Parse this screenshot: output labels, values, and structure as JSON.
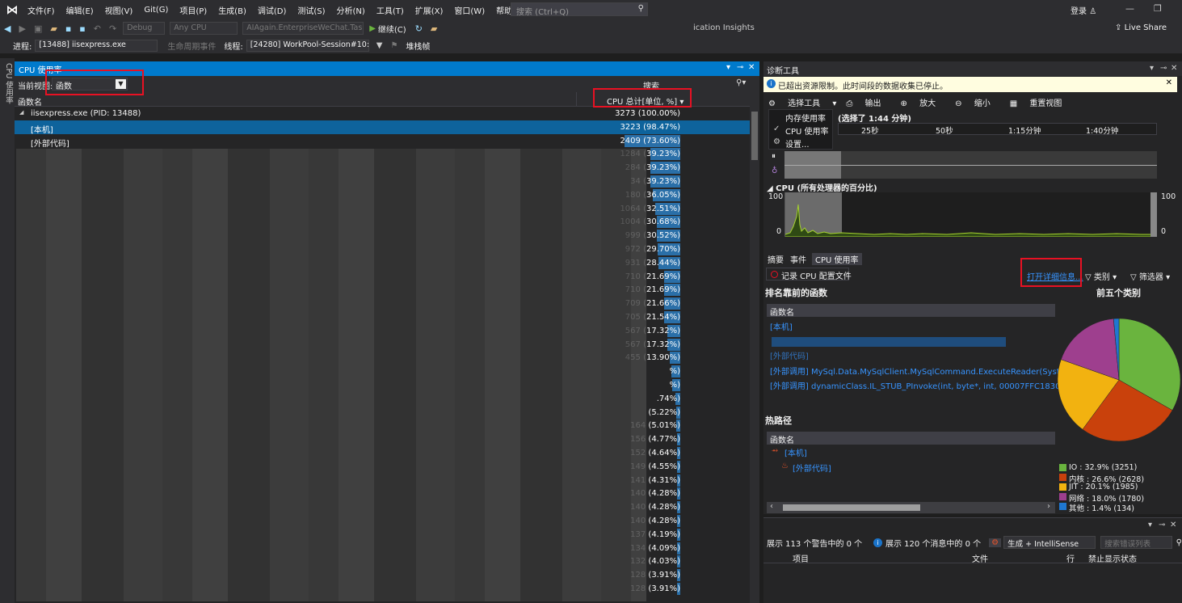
{
  "menubar": {
    "items": [
      "文件(F)",
      "编辑(E)",
      "视图(V)",
      "Git(G)",
      "项目(P)",
      "生成(B)",
      "调试(D)",
      "测试(S)",
      "分析(N)",
      "工具(T)",
      "扩展(X)",
      "窗口(W)",
      "帮助(H)"
    ],
    "search_placeholder": "搜索 (Ctrl+Q)",
    "login": "登录"
  },
  "toolbar": {
    "config": "Debug",
    "platform": "Any CPU",
    "project": "AIAgain.EnterpriseWeChat.Task",
    "continue": "继续(C)",
    "insights": "ication Insights",
    "live_share": "Live Share"
  },
  "procbar": {
    "process_label": "进程:",
    "process_value": "[13488] iisexpress.exe",
    "lifecycle_label": "生命周期事件",
    "thread_label": "线程:",
    "thread_value": "[24280] WorkPool-Session#10:",
    "stack_label": "堆栈帧"
  },
  "sidetab": {
    "label": "CPU 使用率"
  },
  "cpu_panel": {
    "title": "CPU 使用率",
    "current_view_label": "当前视图:",
    "current_view_value": "函数",
    "search_label": "搜索",
    "col_name": "函数名",
    "col_cpu": "CPU 总计[单位, %]",
    "rows": [
      {
        "name": "iisexpress.exe (PID: 13488)",
        "value": "3273 (100.00%)",
        "pct": 100.0
      },
      {
        "name": "[本机]",
        "value": "3223 (98.47%)",
        "pct": 98.47
      },
      {
        "name": "[外部代码]",
        "value": "2409 (73.60%)",
        "pct": 73.6
      },
      {
        "name": "",
        "value": "1284 (39.23%)",
        "pct": 39.23
      },
      {
        "name": "",
        "value": "284 (39.23%)",
        "pct": 39.23
      },
      {
        "name": "",
        "value": "34 (39.23%)",
        "pct": 39.23
      },
      {
        "name": "",
        "value": "180 (36.05%)",
        "pct": 36.05
      },
      {
        "name": "",
        "value": "1064 (32.51%)",
        "pct": 32.51
      },
      {
        "name": "",
        "value": "1004 (30.68%)",
        "pct": 30.68
      },
      {
        "name": "",
        "value": "999 (30.52%)",
        "pct": 30.52
      },
      {
        "name": "",
        "value": "972 (29.70%)",
        "pct": 29.7
      },
      {
        "name": "",
        "value": "931 (28.44%)",
        "pct": 28.44
      },
      {
        "name": "",
        "value": "710 (21.69%)",
        "pct": 21.69
      },
      {
        "name": "",
        "value": "710 (21.69%)",
        "pct": 21.69
      },
      {
        "name": "",
        "value": "709 (21.66%)",
        "pct": 21.66
      },
      {
        "name": "",
        "value": "705 (21.54%)",
        "pct": 21.54
      },
      {
        "name": "",
        "value": "567 (17.32%)",
        "pct": 17.32
      },
      {
        "name": "",
        "value": "567 (17.32%)",
        "pct": 17.32
      },
      {
        "name": "",
        "value": "455 (13.90%)",
        "pct": 13.9
      },
      {
        "name": "",
        "value": "%)",
        "pct": 12.0
      },
      {
        "name": "",
        "value": "%)",
        "pct": 11.0
      },
      {
        "name": "",
        "value": ".74%)",
        "pct": 6.74
      },
      {
        "name": "",
        "value": "(5.22%)",
        "pct": 5.22
      },
      {
        "name": "",
        "value": "164 (5.01%)",
        "pct": 5.01
      },
      {
        "name": "",
        "value": "156 (4.77%)",
        "pct": 4.77
      },
      {
        "name": "",
        "value": "152 (4.64%)",
        "pct": 4.64
      },
      {
        "name": "",
        "value": "149 (4.55%)",
        "pct": 4.55
      },
      {
        "name": "",
        "value": "141 (4.31%)",
        "pct": 4.31
      },
      {
        "name": "",
        "value": "140 (4.28%)",
        "pct": 4.28
      },
      {
        "name": "",
        "value": "140 (4.28%)",
        "pct": 4.28
      },
      {
        "name": "",
        "value": "140 (4.28%)",
        "pct": 4.28
      },
      {
        "name": "",
        "value": "137 (4.19%)",
        "pct": 4.19
      },
      {
        "name": "",
        "value": "134 (4.09%)",
        "pct": 4.09
      },
      {
        "name": "",
        "value": "132 (4.03%)",
        "pct": 4.03
      },
      {
        "name": "",
        "value": "128 (3.91%)",
        "pct": 3.91
      },
      {
        "name": "",
        "value": "128 (3.91%)",
        "pct": 3.91
      }
    ]
  },
  "diag": {
    "title": "诊断工具",
    "info": "已超出资源限制。此时间段的数据收集已停止。",
    "select_tools": "选择工具",
    "output": "输出",
    "zoom_in": "放大",
    "zoom_out": "缩小",
    "reset_view": "重置视图",
    "menu": [
      "内存使用率",
      "CPU 使用率",
      "设置..."
    ],
    "session": "(选择了 1:44 分钟)",
    "ticks": [
      "25秒",
      "50秒",
      "1:15分钟",
      "1:40分钟"
    ],
    "cpu_section": "CPU (所有处理器的百分比)",
    "y_max": "100",
    "y_min": "0",
    "tabs": [
      "摘要",
      "事件",
      "CPU 使用率"
    ],
    "record_btn": "记录 CPU 配置文件",
    "open_details": "打开详细信息...",
    "category": "类别",
    "filter": "筛选器",
    "top_functions_title": "排名靠前的函数",
    "top_categories_title": "前五个类别",
    "col_fn": "函数名",
    "top_functions": [
      "[本机]",
      "[外部代码]",
      "[外部调用] MySql.Data.MySqlClient.MySqlCommand.ExecuteReader(System.Data",
      "[外部调用] dynamicClass.IL_STUB_PInvoke(int, byte*, int, 00007FFC1830C2C8)"
    ],
    "hot_path_title": "热路径",
    "hot_path": [
      "[本机]",
      "[外部代码]"
    ]
  },
  "categories": [
    {
      "label": "IO : 32.9% (3251)",
      "value": 32.9,
      "color": "#6ab43e"
    },
    {
      "label": "内核 : 26.6% (2628)",
      "value": 26.6,
      "color": "#c9410c"
    },
    {
      "label": "JIT : 20.1% (1985)",
      "value": 20.1,
      "color": "#f2b210"
    },
    {
      "label": "网络 : 18.0% (1780)",
      "value": 18.0,
      "color": "#9e3f8e"
    },
    {
      "label": "其他 : 1.4% (134)",
      "value": 1.4,
      "color": "#1f77d0"
    }
  ],
  "errlist": {
    "warnings": "展示 113 个警告中的 0 个",
    "messages": "展示 120 个消息中的 0 个",
    "build": "生成 + IntelliSense",
    "search": "搜索错误列表",
    "cols": [
      "项目",
      "文件",
      "行",
      "禁止显示状态"
    ]
  }
}
